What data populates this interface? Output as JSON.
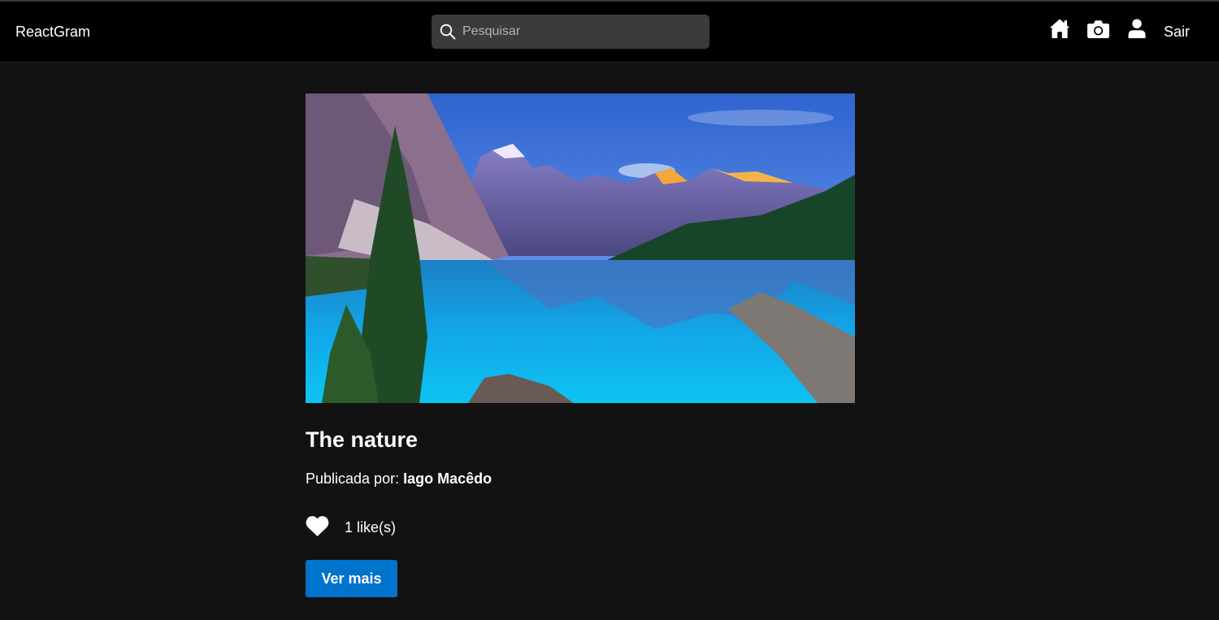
{
  "navbar": {
    "brand": "ReactGram",
    "search_placeholder": "Pesquisar",
    "search_value": "",
    "icons": [
      "home-icon",
      "camera-icon",
      "user-icon"
    ],
    "logout_label": "Sair"
  },
  "post": {
    "title": "The nature",
    "author_prefix": "Publicada por:",
    "author_name": "Iago Macêdo",
    "likes_text": "1 like(s)",
    "liked": true,
    "more_button_label": "Ver mais"
  },
  "colors": {
    "page_background": "#121212",
    "navbar_background": "#000000",
    "search_background": "#3b3b3b",
    "button_background": "#0073cc",
    "text": "#ffffff"
  }
}
